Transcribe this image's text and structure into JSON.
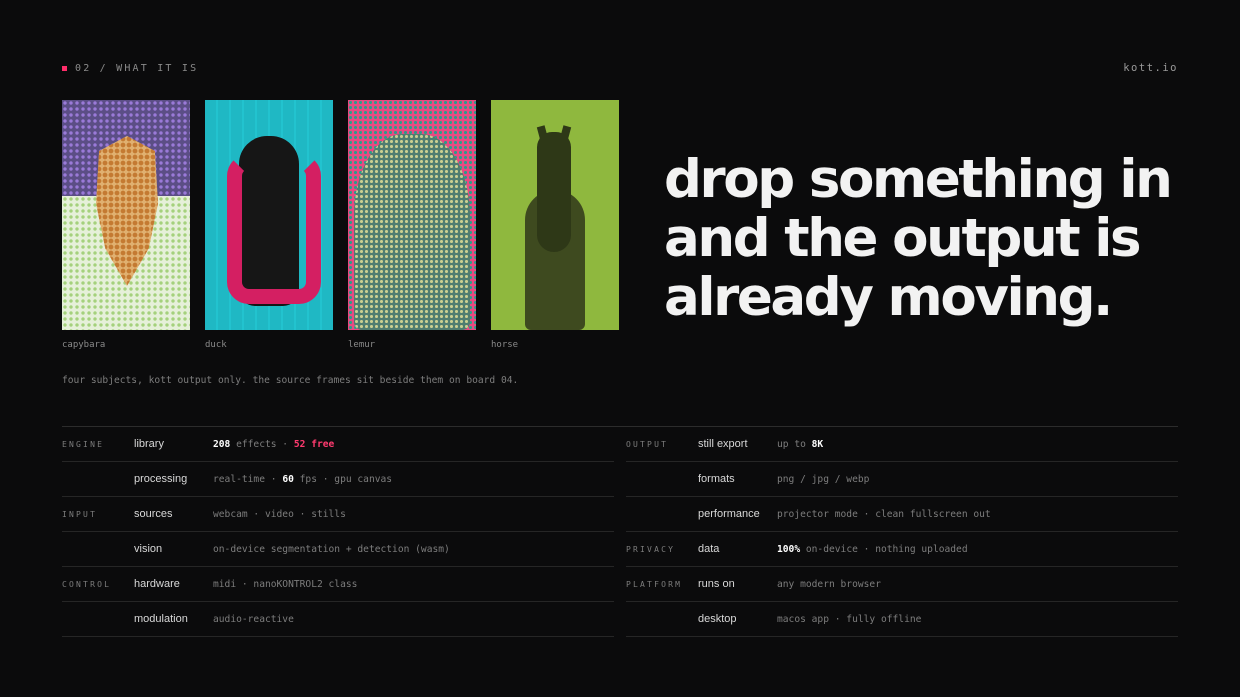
{
  "header": {
    "section": "02 / WHAT IT IS",
    "brand": "kott.io",
    "accent": "#ff2d6a"
  },
  "tiles": [
    {
      "caption": "capybara"
    },
    {
      "caption": "duck"
    },
    {
      "caption": "lemur"
    },
    {
      "caption": "horse"
    }
  ],
  "headline": {
    "line1": "drop something in",
    "line2": "and the output is",
    "line3": "already moving."
  },
  "note": "four subjects, kott output only. the source frames sit beside them on board 04.",
  "specs": {
    "left": [
      {
        "section": "ENGINE",
        "label": "library",
        "v1": "208",
        "v2": " effects · ",
        "v3": "52 free"
      },
      {
        "section": "",
        "label": "processing",
        "v1": "real-time · ",
        "v2": "60",
        "v3": " fps · gpu canvas"
      },
      {
        "section": "INPUT",
        "label": "sources",
        "value": "webcam · video · stills"
      },
      {
        "section": "",
        "label": "vision",
        "value": "on-device segmentation + detection (wasm)"
      },
      {
        "section": "CONTROL",
        "label": "hardware",
        "value": "midi · nanoKONTROL2 class"
      },
      {
        "section": "",
        "label": "modulation",
        "value": "audio-reactive"
      }
    ],
    "right": [
      {
        "section": "OUTPUT",
        "label": "still export",
        "v1": "up to ",
        "v2": "8K"
      },
      {
        "section": "",
        "label": "formats",
        "value": "png / jpg / webp"
      },
      {
        "section": "",
        "label": "performance",
        "value": "projector mode · clean fullscreen out"
      },
      {
        "section": "PRIVACY",
        "label": "data",
        "v1": "100%",
        "v2": " on-device · nothing uploaded"
      },
      {
        "section": "PLATFORM",
        "label": "runs on",
        "value": "any modern browser"
      },
      {
        "section": "",
        "label": "desktop",
        "value": "macos app · fully offline"
      }
    ]
  }
}
